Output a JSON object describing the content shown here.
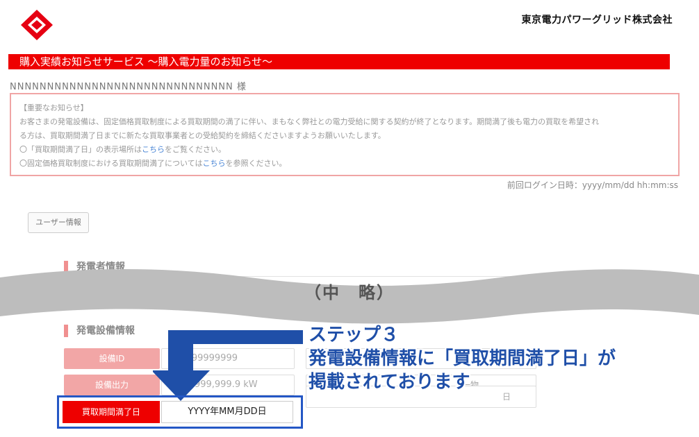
{
  "header": {
    "company": "東京電力パワーグリッド株式会社",
    "logo_icon": "tepco-logo-icon",
    "title": "購入実績お知らせサービス ～購入電力量のお知らせ～"
  },
  "customer_name": "NNNNNNNNNNNNNNNNNNNNNNNNNNNNNN 様",
  "notice": {
    "heading": "【重要なお知らせ】",
    "line1": "お客さまの発電設備は、固定価格買取制度による買取期間の満了に伴い、まもなく弊社との電力受給に関する契約が終了となります。期間満了後も電力の買取を希望され",
    "line2": "る方は、買取期間満了日までに新たな買取事業者との受給契約を締結くださいますようお願いいたします。",
    "line3_pre": "〇「買取期間満了日」の表示場所は",
    "line3_link": "こちら",
    "line3_post": "をご覧ください。",
    "line4_pre": "〇固定価格買取制度における買取期間満了については",
    "line4_link": "こちら",
    "line4_post": "を参照ください。"
  },
  "last_login": "前回ログイン日時：yyyy/mm/dd hh:mm:ss",
  "user_button": "ユーザー情報",
  "sections": {
    "generator": "発電者情報",
    "equipment": "発電設備情報"
  },
  "omitted": "（中　略）",
  "rows": [
    {
      "label": "設備ID",
      "value": "99999999999"
    },
    {
      "label": "設備出力",
      "value": "999,999,999.9 kW"
    }
  ],
  "expiry": {
    "label": "買取期間満了日",
    "value": "YYYY年MM月DD日"
  },
  "right_fragments": {
    "row1": "",
    "row2": "一物",
    "row3": "日"
  },
  "callout": {
    "line1": "ステップ３",
    "line2": "発電設備情報に「買取期間満了日」が",
    "line3": "掲載されております"
  },
  "colors": {
    "brand_red": "#ee0000",
    "pink": "#f2a6a6",
    "callout_blue": "#1f4fa8",
    "highlight_blue": "#2457c5"
  }
}
